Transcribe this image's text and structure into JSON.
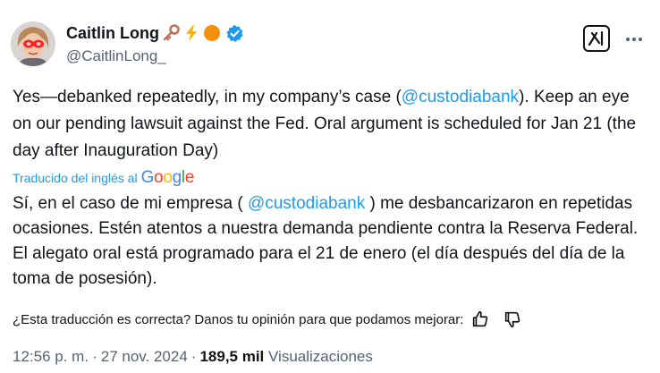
{
  "author": {
    "display_name": "Caitlin Long",
    "handle": "@CaitlinLong_",
    "name_emojis": [
      "key-emoji",
      "lightning-emoji",
      "orange-circle-emoji"
    ],
    "verified": true
  },
  "tweet": {
    "text_before_mention": "Yes—debanked repeatedly, in my company’s case (",
    "mention": "@custodiabank",
    "text_after_mention": "). Keep an eye on our pending lawsuit against the Fed. Oral argument is scheduled for Jan 21 (the day after Inauguration Day)"
  },
  "translation": {
    "label": "Traducido del inglés al",
    "provider": "Google",
    "text_before_mention": "Sí, en el caso de mi empresa ( ",
    "mention": "@custodiabank",
    "text_after_mention": " ) me desbancarizaron en repetidas ocasiones. Estén atentos a nuestra demanda pendiente contra la Reserva Federal. El alegato oral está programado para el 21 de enero (el día después del día de la toma de posesión)."
  },
  "feedback": {
    "question": "¿Esta traducción es correcta? Danos tu opinión para que podamos mejorar:"
  },
  "meta": {
    "time": "12:56 p. m.",
    "separator": "·",
    "date": "27 nov. 2024",
    "views_count": "189,5 mil",
    "views_label": "Visualizaciones"
  },
  "colors": {
    "accent": "#1d9bf0",
    "text": "#0f1419",
    "secondary": "#536471"
  }
}
